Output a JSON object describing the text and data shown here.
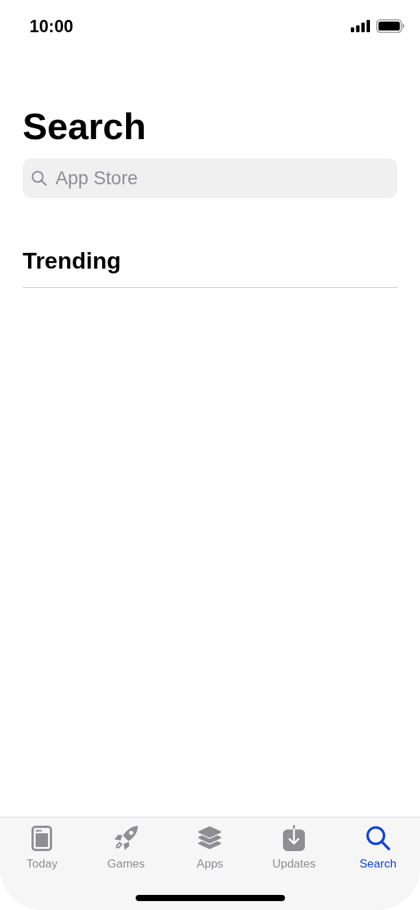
{
  "status_bar": {
    "time": "10:00"
  },
  "title": "Search",
  "search": {
    "placeholder": "App Store"
  },
  "sections": [
    {
      "title": "Trending"
    }
  ],
  "tab_bar": {
    "tabs": [
      {
        "label": "Today",
        "kind": "today",
        "selected": false
      },
      {
        "label": "Games",
        "kind": "games",
        "selected": false
      },
      {
        "label": "Apps",
        "kind": "apps",
        "selected": false
      },
      {
        "label": "Updates",
        "kind": "updates",
        "selected": false
      },
      {
        "label": "Search",
        "kind": "search",
        "selected": true
      }
    ]
  }
}
